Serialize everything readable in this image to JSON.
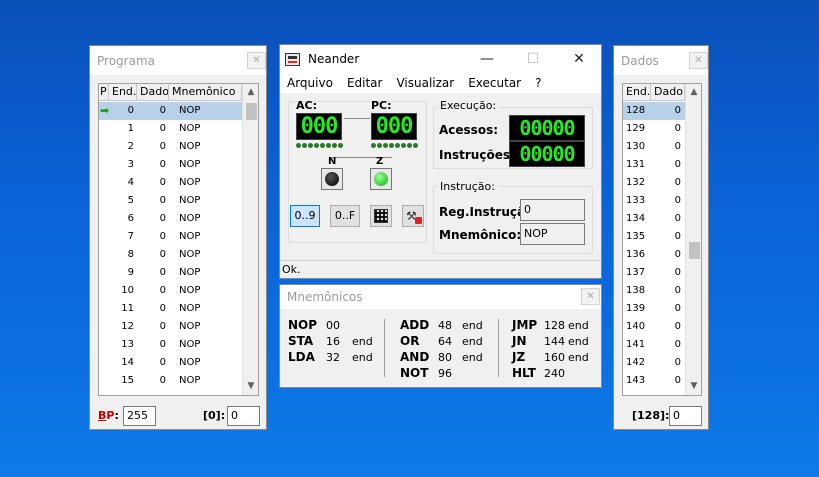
{
  "programa": {
    "title": "Programa",
    "columns": [
      "P",
      "End.",
      "Dado",
      "Mnemônico"
    ],
    "rows": [
      {
        "end": "0",
        "dado": "0",
        "mnem": "NOP"
      },
      {
        "end": "1",
        "dado": "0",
        "mnem": "NOP"
      },
      {
        "end": "2",
        "dado": "0",
        "mnem": "NOP"
      },
      {
        "end": "3",
        "dado": "0",
        "mnem": "NOP"
      },
      {
        "end": "4",
        "dado": "0",
        "mnem": "NOP"
      },
      {
        "end": "5",
        "dado": "0",
        "mnem": "NOP"
      },
      {
        "end": "6",
        "dado": "0",
        "mnem": "NOP"
      },
      {
        "end": "7",
        "dado": "0",
        "mnem": "NOP"
      },
      {
        "end": "8",
        "dado": "0",
        "mnem": "NOP"
      },
      {
        "end": "9",
        "dado": "0",
        "mnem": "NOP"
      },
      {
        "end": "10",
        "dado": "0",
        "mnem": "NOP"
      },
      {
        "end": "11",
        "dado": "0",
        "mnem": "NOP"
      },
      {
        "end": "12",
        "dado": "0",
        "mnem": "NOP"
      },
      {
        "end": "13",
        "dado": "0",
        "mnem": "NOP"
      },
      {
        "end": "14",
        "dado": "0",
        "mnem": "NOP"
      },
      {
        "end": "15",
        "dado": "0",
        "mnem": "NOP"
      }
    ],
    "bp_label": "BP:",
    "bp_value": "255",
    "addr_label": "[0]:",
    "addr_value": "0"
  },
  "neander": {
    "title": "Neander",
    "menu": [
      "Arquivo",
      "Editar",
      "Visualizar",
      "Executar",
      "?"
    ],
    "ac_label": "AC:",
    "ac_value": "000",
    "pc_label": "PC:",
    "pc_value": "000",
    "n_label": "N",
    "z_label": "Z",
    "execucao_label": "Execução:",
    "acessos_label": "Acessos:",
    "acessos_value": "00000",
    "instrucoes_label": "Instruções:",
    "instrucoes_value": "00000",
    "instrucao_label": "Instrução:",
    "reg_instrucao_label": "Reg.Instrução:",
    "reg_instrucao_value": "0",
    "mnemonico_label": "Mnemônico:",
    "mnemonico_value": "NOP",
    "btn_dec": "0..9",
    "btn_hex": "0..F",
    "status": "Ok.",
    "colors": {
      "lcd_fg": "#28e628",
      "led_n": "#111111",
      "led_z": "#22cc22"
    }
  },
  "mnemonicos": {
    "title": "Mnemônicos",
    "col1": [
      {
        "op": "NOP",
        "code": "00",
        "arg": ""
      },
      {
        "op": "STA",
        "code": "16",
        "arg": "end"
      },
      {
        "op": "LDA",
        "code": "32",
        "arg": "end"
      }
    ],
    "col2": [
      {
        "op": "ADD",
        "code": "48",
        "arg": "end"
      },
      {
        "op": "OR",
        "code": "64",
        "arg": "end"
      },
      {
        "op": "AND",
        "code": "80",
        "arg": "end"
      },
      {
        "op": "NOT",
        "code": "96",
        "arg": ""
      }
    ],
    "col3": [
      {
        "op": "JMP",
        "code": "128",
        "arg": "end"
      },
      {
        "op": "JN",
        "code": "144",
        "arg": "end"
      },
      {
        "op": "JZ",
        "code": "160",
        "arg": "end"
      },
      {
        "op": "HLT",
        "code": "240",
        "arg": ""
      }
    ]
  },
  "dados": {
    "title": "Dados",
    "columns": [
      "End.",
      "Dado"
    ],
    "rows": [
      {
        "end": "128",
        "dado": "0"
      },
      {
        "end": "129",
        "dado": "0"
      },
      {
        "end": "130",
        "dado": "0"
      },
      {
        "end": "131",
        "dado": "0"
      },
      {
        "end": "132",
        "dado": "0"
      },
      {
        "end": "133",
        "dado": "0"
      },
      {
        "end": "134",
        "dado": "0"
      },
      {
        "end": "135",
        "dado": "0"
      },
      {
        "end": "136",
        "dado": "0"
      },
      {
        "end": "137",
        "dado": "0"
      },
      {
        "end": "138",
        "dado": "0"
      },
      {
        "end": "139",
        "dado": "0"
      },
      {
        "end": "140",
        "dado": "0"
      },
      {
        "end": "141",
        "dado": "0"
      },
      {
        "end": "142",
        "dado": "0"
      },
      {
        "end": "143",
        "dado": "0"
      }
    ],
    "addr_label": "[128]:",
    "addr_value": "0"
  }
}
